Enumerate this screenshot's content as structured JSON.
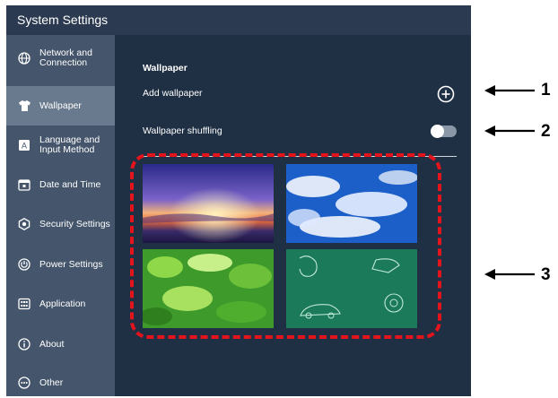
{
  "window": {
    "title": "System Settings"
  },
  "sidebar": {
    "items": [
      {
        "label": "Network and Connection",
        "icon": "globe-icon",
        "active": false
      },
      {
        "label": "Wallpaper",
        "icon": "shirt-icon",
        "active": true
      },
      {
        "label": "Language and Input Method",
        "icon": "language-icon",
        "active": false
      },
      {
        "label": "Date and Time",
        "icon": "calendar-icon",
        "active": false
      },
      {
        "label": "Security Settings",
        "icon": "shield-icon",
        "active": false
      },
      {
        "label": "Power Settings",
        "icon": "power-icon",
        "active": false
      },
      {
        "label": "Application",
        "icon": "app-grid-icon",
        "active": false
      },
      {
        "label": "About",
        "icon": "info-icon",
        "active": false
      },
      {
        "label": "Other",
        "icon": "more-icon",
        "active": false
      }
    ]
  },
  "main": {
    "section_title": "Wallpaper",
    "add_wallpaper_label": "Add wallpaper",
    "shuffle_label": "Wallpaper shuffling",
    "shuffle_enabled": false,
    "thumbnails": [
      {
        "name": "sunset",
        "selected": false
      },
      {
        "name": "sky-clouds",
        "selected": false
      },
      {
        "name": "green-leaves",
        "selected": false
      },
      {
        "name": "green-sketch",
        "selected": false
      }
    ]
  },
  "annotations": {
    "callout_1": "1",
    "callout_2": "2",
    "callout_3": "3",
    "highlight_color": "#e3141b"
  },
  "colors": {
    "sidebar_bg": "#45566c",
    "sidebar_active": "#6a7a8e",
    "main_bg": "#1f2f44",
    "titlebar_bg": "#2b3a50"
  }
}
